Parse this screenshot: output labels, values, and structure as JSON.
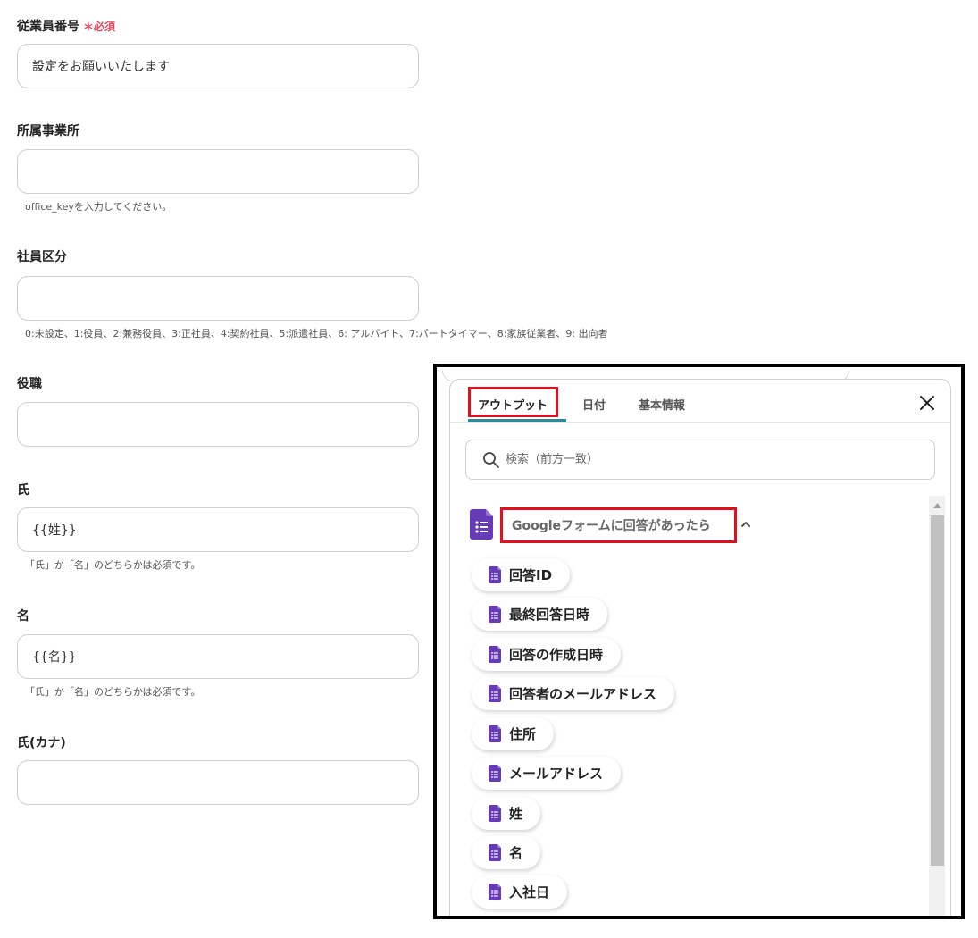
{
  "form": {
    "employee_number": {
      "label": "従業員番号",
      "required": "＊必須",
      "value": "設定をお願いいたします"
    },
    "office": {
      "label": "所属事業所",
      "value": "",
      "help": "office_keyを入力してください。"
    },
    "employee_type": {
      "label": "社員区分",
      "value": "",
      "help": "0:未設定、1:役員、2:兼務役員、3:正社員、4:契約社員、5:派遣社員、6: アルバイト、7:パートタイマー、8:家族従業者、9: 出向者"
    },
    "position": {
      "label": "役職",
      "value": ""
    },
    "last_name": {
      "label": "氏",
      "value": "{{姓}}",
      "help": "「氏」か「名」のどちらかは必須です。"
    },
    "first_name": {
      "label": "名",
      "value": "{{名}}",
      "help": "「氏」か「名」のどちらかは必須です。"
    },
    "last_name_kana": {
      "label": "氏(カナ)",
      "value": ""
    }
  },
  "popup": {
    "tabs": [
      {
        "label": "アウトプット",
        "active": true
      },
      {
        "label": "日付",
        "active": false
      },
      {
        "label": "基本情報",
        "active": false
      }
    ],
    "search": {
      "placeholder": "検索（前方一致）"
    },
    "group": {
      "title": "Googleフォームに回答があったら",
      "icon": "google-forms-icon"
    },
    "items": [
      {
        "label": "回答ID"
      },
      {
        "label": "最終回答日時"
      },
      {
        "label": "回答の作成日時"
      },
      {
        "label": "回答者のメールアドレス"
      },
      {
        "label": "住所"
      },
      {
        "label": "メールアドレス"
      },
      {
        "label": "姓"
      },
      {
        "label": "名"
      },
      {
        "label": "入社日"
      }
    ]
  },
  "colors": {
    "required": "#e8455b",
    "highlight_box": "#e0101e",
    "forms_purple": "#673ab7",
    "tab_underline": "#2a8b9a"
  }
}
